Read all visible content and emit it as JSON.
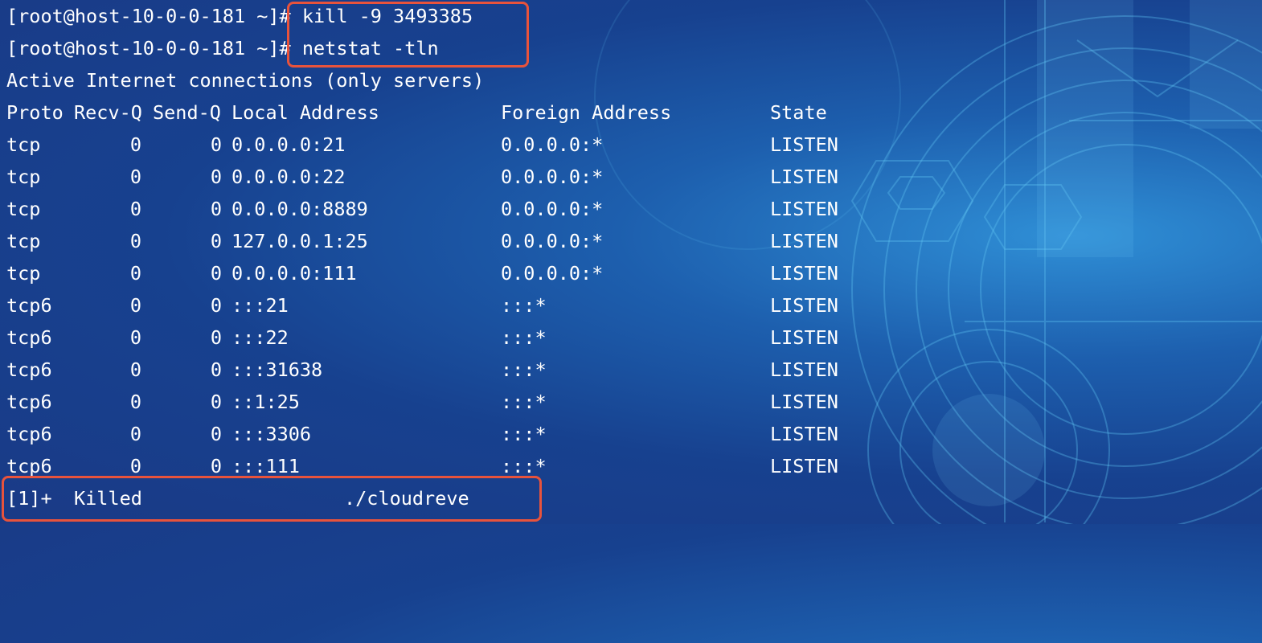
{
  "terminal": {
    "prompt_lines": [
      {
        "prompt": "[root@host-10-0-0-181 ~]#",
        "command": "kill -9 3493385"
      },
      {
        "prompt": "[root@host-10-0-0-181 ~]#",
        "command": "netstat -tln"
      }
    ],
    "output_title": "Active Internet connections (only servers)",
    "table": {
      "headers": [
        "Proto",
        "Recv-Q",
        "Send-Q",
        "Local Address",
        "Foreign Address",
        "State"
      ],
      "rows": [
        [
          "tcp",
          "0",
          "0",
          "0.0.0.0:21",
          "0.0.0.0:*",
          "LISTEN"
        ],
        [
          "tcp",
          "0",
          "0",
          "0.0.0.0:22",
          "0.0.0.0:*",
          "LISTEN"
        ],
        [
          "tcp",
          "0",
          "0",
          "0.0.0.0:8889",
          "0.0.0.0:*",
          "LISTEN"
        ],
        [
          "tcp",
          "0",
          "0",
          "127.0.0.1:25",
          "0.0.0.0:*",
          "LISTEN"
        ],
        [
          "tcp",
          "0",
          "0",
          "0.0.0.0:111",
          "0.0.0.0:*",
          "LISTEN"
        ],
        [
          "tcp6",
          "0",
          "0",
          ":::21",
          ":::*",
          "LISTEN"
        ],
        [
          "tcp6",
          "0",
          "0",
          ":::22",
          ":::*",
          "LISTEN"
        ],
        [
          "tcp6",
          "0",
          "0",
          ":::31638",
          ":::*",
          "LISTEN"
        ],
        [
          "tcp6",
          "0",
          "0",
          "::1:25",
          ":::*",
          "LISTEN"
        ],
        [
          "tcp6",
          "0",
          "0",
          ":::3306",
          ":::*",
          "LISTEN"
        ],
        [
          "tcp6",
          "0",
          "0",
          ":::111",
          ":::*",
          "LISTEN"
        ]
      ]
    },
    "job_status": {
      "job": "[1]+",
      "status": "Killed",
      "command": "./cloudreve"
    }
  },
  "colors": {
    "text": "#ffffff",
    "highlight_border": "#e8533c",
    "background": "#1d5fae"
  }
}
